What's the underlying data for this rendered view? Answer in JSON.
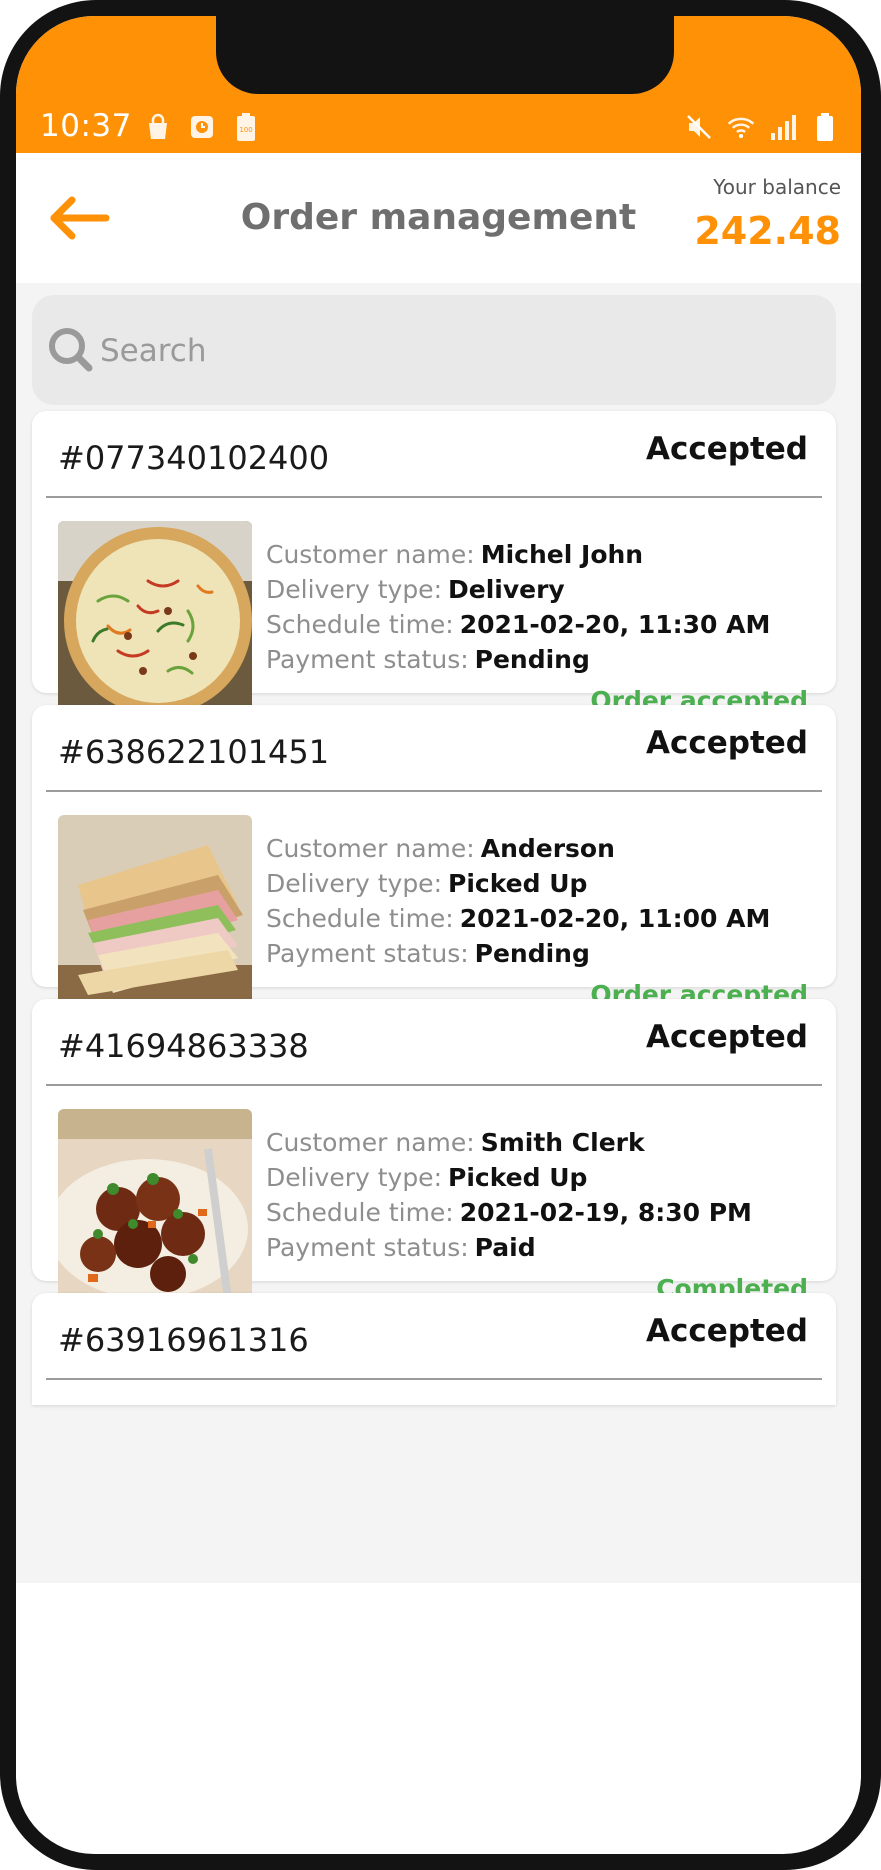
{
  "status_bar": {
    "time": "10:37"
  },
  "header": {
    "title": "Order management",
    "balance_label": "Your balance",
    "balance_value": "242.48"
  },
  "search": {
    "placeholder": "Search"
  },
  "orders": [
    {
      "id": "#077340102400",
      "status": "Accepted",
      "labels": {
        "customer": "Customer name:",
        "delivery": "Delivery type:",
        "schedule": "Schedule time:",
        "payment": "Payment status:"
      },
      "customer_name": "Michel John",
      "delivery_type": "Delivery",
      "schedule_time": "2021-02-20, 11:30 AM",
      "payment_status": "Pending",
      "action": "Order accepted",
      "image": "pizza"
    },
    {
      "id": "#638622101451",
      "status": "Accepted",
      "labels": {
        "customer": "Customer name:",
        "delivery": "Delivery type:",
        "schedule": "Schedule time:",
        "payment": "Payment status:"
      },
      "customer_name": "Anderson",
      "delivery_type": "Picked Up",
      "schedule_time": "2021-02-20, 11:00 AM",
      "payment_status": "Pending",
      "action": "Order accepted",
      "image": "sandwich"
    },
    {
      "id": "#41694863338",
      "status": "Accepted",
      "labels": {
        "customer": "Customer name:",
        "delivery": "Delivery type:",
        "schedule": "Schedule time:",
        "payment": "Payment status:"
      },
      "customer_name": "Smith Clerk",
      "delivery_type": "Picked Up",
      "schedule_time": "2021-02-19, 8:30 PM",
      "payment_status": "Paid",
      "action": "Completed",
      "image": "meatballs"
    },
    {
      "id": "#63916961316",
      "status": "Accepted"
    }
  ],
  "colors": {
    "accent": "#ff9106",
    "success": "#4caf50",
    "background": "#f4f4f4"
  }
}
